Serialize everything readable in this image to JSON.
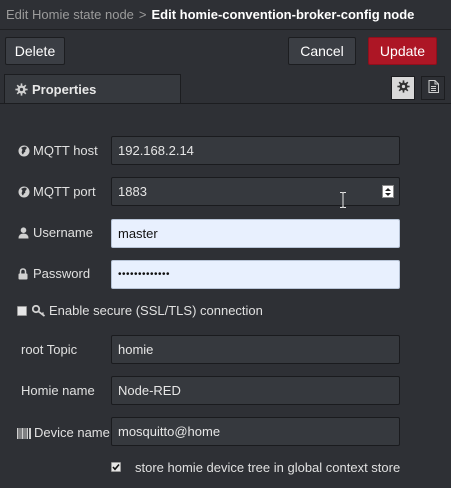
{
  "title": {
    "parent": "Edit Homie state node",
    "separator": ">",
    "current": "Edit homie-convention-broker-config node"
  },
  "toolbar": {
    "delete_label": "Delete",
    "cancel_label": "Cancel",
    "update_label": "Update"
  },
  "tabs": {
    "properties_label": "Properties",
    "properties_icon": "gear-icon",
    "side_tabs": [
      "gear-icon",
      "document-icon"
    ]
  },
  "form": {
    "mqtt_host": {
      "label": "MQTT host",
      "icon": "globe-icon",
      "value": "192.168.2.14"
    },
    "mqtt_port": {
      "label": "MQTT port",
      "icon": "globe-icon",
      "value": "1883"
    },
    "username": {
      "label": "Username",
      "icon": "user-icon",
      "value": "master"
    },
    "password": {
      "label": "Password",
      "icon": "lock-icon",
      "value": "•••••••••••••"
    },
    "secure": {
      "label": "Enable secure (SSL/TLS) connection",
      "icon": "key-icon",
      "checked": false
    },
    "root_topic": {
      "label": "root Topic",
      "value": "homie"
    },
    "homie_name": {
      "label": "Homie name",
      "value": "Node-RED"
    },
    "device_name": {
      "label": "Device name",
      "icon": "barcode-icon",
      "value": "mosquitto@home"
    },
    "store_tree": {
      "label": "store homie device tree in global context store",
      "checked": true
    }
  },
  "colors": {
    "background": "#2e3035",
    "input_dark": "#36393e",
    "input_autofill": "#e8f0fe",
    "update_button": "#ad1625"
  }
}
